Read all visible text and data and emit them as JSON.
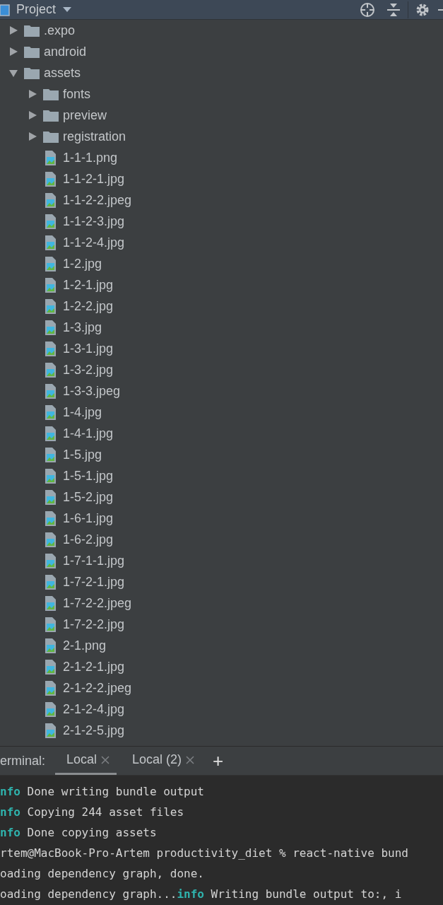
{
  "panel": {
    "title": "Project"
  },
  "tree": [
    {
      "name": ".expo",
      "kind": "folder",
      "expanded": false
    },
    {
      "name": "android",
      "kind": "folder",
      "expanded": false
    },
    {
      "name": "assets",
      "kind": "folder",
      "expanded": true,
      "children": [
        {
          "name": "fonts",
          "kind": "folder",
          "expanded": false
        },
        {
          "name": "preview",
          "kind": "folder",
          "expanded": false
        },
        {
          "name": "registration",
          "kind": "folder",
          "expanded": false
        },
        {
          "name": "1-1-1.png",
          "kind": "image"
        },
        {
          "name": "1-1-2-1.jpg",
          "kind": "image"
        },
        {
          "name": "1-1-2-2.jpeg",
          "kind": "image"
        },
        {
          "name": "1-1-2-3.jpg",
          "kind": "image"
        },
        {
          "name": "1-1-2-4.jpg",
          "kind": "image"
        },
        {
          "name": "1-2.jpg",
          "kind": "image"
        },
        {
          "name": "1-2-1.jpg",
          "kind": "image"
        },
        {
          "name": "1-2-2.jpg",
          "kind": "image"
        },
        {
          "name": "1-3.jpg",
          "kind": "image"
        },
        {
          "name": "1-3-1.jpg",
          "kind": "image"
        },
        {
          "name": "1-3-2.jpg",
          "kind": "image"
        },
        {
          "name": "1-3-3.jpeg",
          "kind": "image"
        },
        {
          "name": "1-4.jpg",
          "kind": "image"
        },
        {
          "name": "1-4-1.jpg",
          "kind": "image"
        },
        {
          "name": "1-5.jpg",
          "kind": "image"
        },
        {
          "name": "1-5-1.jpg",
          "kind": "image"
        },
        {
          "name": "1-5-2.jpg",
          "kind": "image"
        },
        {
          "name": "1-6-1.jpg",
          "kind": "image"
        },
        {
          "name": "1-6-2.jpg",
          "kind": "image"
        },
        {
          "name": "1-7-1-1.jpg",
          "kind": "image"
        },
        {
          "name": "1-7-2-1.jpg",
          "kind": "image"
        },
        {
          "name": "1-7-2-2.jpeg",
          "kind": "image"
        },
        {
          "name": "1-7-2-2.jpg",
          "kind": "image"
        },
        {
          "name": "2-1.png",
          "kind": "image"
        },
        {
          "name": "2-1-2-1.jpg",
          "kind": "image"
        },
        {
          "name": "2-1-2-2.jpeg",
          "kind": "image"
        },
        {
          "name": "2-1-2-4.jpg",
          "kind": "image"
        },
        {
          "name": "2-1-2-5.jpg",
          "kind": "image"
        }
      ]
    }
  ],
  "terminal": {
    "label": "erminal:",
    "tabs": [
      {
        "label": "Local",
        "selected": true
      },
      {
        "label": "Local (2)",
        "selected": false
      }
    ],
    "new_tab": "+",
    "lines": [
      [
        {
          "text": "nfo",
          "kind": "info"
        },
        {
          "text": " Done writing bundle output",
          "kind": "plain"
        }
      ],
      [
        {
          "text": "nfo",
          "kind": "info"
        },
        {
          "text": " Copying 244 asset files",
          "kind": "plain"
        }
      ],
      [
        {
          "text": "nfo",
          "kind": "info"
        },
        {
          "text": " Done copying assets",
          "kind": "plain"
        }
      ],
      [
        {
          "text": "rtem@MacBook-Pro-Artem productivity_diet % react-native bund",
          "kind": "plain"
        }
      ],
      [
        {
          "text": "oading dependency graph, done.",
          "kind": "plain"
        }
      ],
      [
        {
          "text": "oading dependency graph...",
          "kind": "plain"
        },
        {
          "text": "info",
          "kind": "info"
        },
        {
          "text": " Writing bundle output to:, i",
          "kind": "plain"
        }
      ]
    ]
  }
}
